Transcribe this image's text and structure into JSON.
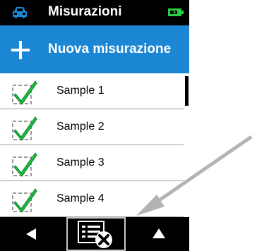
{
  "header": {
    "title": "Misurazioni",
    "left_icon": "car-icon",
    "right_icon": "battery-icon"
  },
  "new_measurement": {
    "label": "Nuova misurazione",
    "icon": "plus-icon"
  },
  "list": {
    "items": [
      {
        "label": "Sample 1",
        "checked": true
      },
      {
        "label": "Sample 2",
        "checked": true
      },
      {
        "label": "Sample 3",
        "checked": true
      },
      {
        "label": "Sample 4",
        "checked": true
      }
    ]
  },
  "toolbar": {
    "buttons": [
      {
        "icon": "back-triangle-icon"
      },
      {
        "icon": "delete-list-icon"
      },
      {
        "icon": "up-triangle-icon"
      }
    ]
  },
  "colors": {
    "accent_blue": "#1b86d3",
    "check_green": "#18c23a",
    "battery_green": "#2ecc40",
    "arrow_gray": "#b4b4b4"
  }
}
